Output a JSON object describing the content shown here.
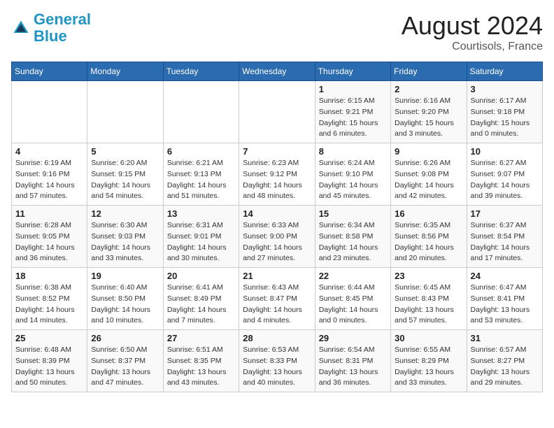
{
  "header": {
    "logo_line1": "General",
    "logo_line2": "Blue",
    "month": "August 2024",
    "location": "Courtisols, France"
  },
  "weekdays": [
    "Sunday",
    "Monday",
    "Tuesday",
    "Wednesday",
    "Thursday",
    "Friday",
    "Saturday"
  ],
  "weeks": [
    [
      {
        "day": "",
        "info": ""
      },
      {
        "day": "",
        "info": ""
      },
      {
        "day": "",
        "info": ""
      },
      {
        "day": "",
        "info": ""
      },
      {
        "day": "1",
        "info": "Sunrise: 6:15 AM\nSunset: 9:21 PM\nDaylight: 15 hours\nand 6 minutes."
      },
      {
        "day": "2",
        "info": "Sunrise: 6:16 AM\nSunset: 9:20 PM\nDaylight: 15 hours\nand 3 minutes."
      },
      {
        "day": "3",
        "info": "Sunrise: 6:17 AM\nSunset: 9:18 PM\nDaylight: 15 hours\nand 0 minutes."
      }
    ],
    [
      {
        "day": "4",
        "info": "Sunrise: 6:19 AM\nSunset: 9:16 PM\nDaylight: 14 hours\nand 57 minutes."
      },
      {
        "day": "5",
        "info": "Sunrise: 6:20 AM\nSunset: 9:15 PM\nDaylight: 14 hours\nand 54 minutes."
      },
      {
        "day": "6",
        "info": "Sunrise: 6:21 AM\nSunset: 9:13 PM\nDaylight: 14 hours\nand 51 minutes."
      },
      {
        "day": "7",
        "info": "Sunrise: 6:23 AM\nSunset: 9:12 PM\nDaylight: 14 hours\nand 48 minutes."
      },
      {
        "day": "8",
        "info": "Sunrise: 6:24 AM\nSunset: 9:10 PM\nDaylight: 14 hours\nand 45 minutes."
      },
      {
        "day": "9",
        "info": "Sunrise: 6:26 AM\nSunset: 9:08 PM\nDaylight: 14 hours\nand 42 minutes."
      },
      {
        "day": "10",
        "info": "Sunrise: 6:27 AM\nSunset: 9:07 PM\nDaylight: 14 hours\nand 39 minutes."
      }
    ],
    [
      {
        "day": "11",
        "info": "Sunrise: 6:28 AM\nSunset: 9:05 PM\nDaylight: 14 hours\nand 36 minutes."
      },
      {
        "day": "12",
        "info": "Sunrise: 6:30 AM\nSunset: 9:03 PM\nDaylight: 14 hours\nand 33 minutes."
      },
      {
        "day": "13",
        "info": "Sunrise: 6:31 AM\nSunset: 9:01 PM\nDaylight: 14 hours\nand 30 minutes."
      },
      {
        "day": "14",
        "info": "Sunrise: 6:33 AM\nSunset: 9:00 PM\nDaylight: 14 hours\nand 27 minutes."
      },
      {
        "day": "15",
        "info": "Sunrise: 6:34 AM\nSunset: 8:58 PM\nDaylight: 14 hours\nand 23 minutes."
      },
      {
        "day": "16",
        "info": "Sunrise: 6:35 AM\nSunset: 8:56 PM\nDaylight: 14 hours\nand 20 minutes."
      },
      {
        "day": "17",
        "info": "Sunrise: 6:37 AM\nSunset: 8:54 PM\nDaylight: 14 hours\nand 17 minutes."
      }
    ],
    [
      {
        "day": "18",
        "info": "Sunrise: 6:38 AM\nSunset: 8:52 PM\nDaylight: 14 hours\nand 14 minutes."
      },
      {
        "day": "19",
        "info": "Sunrise: 6:40 AM\nSunset: 8:50 PM\nDaylight: 14 hours\nand 10 minutes."
      },
      {
        "day": "20",
        "info": "Sunrise: 6:41 AM\nSunset: 8:49 PM\nDaylight: 14 hours\nand 7 minutes."
      },
      {
        "day": "21",
        "info": "Sunrise: 6:43 AM\nSunset: 8:47 PM\nDaylight: 14 hours\nand 4 minutes."
      },
      {
        "day": "22",
        "info": "Sunrise: 6:44 AM\nSunset: 8:45 PM\nDaylight: 14 hours\nand 0 minutes."
      },
      {
        "day": "23",
        "info": "Sunrise: 6:45 AM\nSunset: 8:43 PM\nDaylight: 13 hours\nand 57 minutes."
      },
      {
        "day": "24",
        "info": "Sunrise: 6:47 AM\nSunset: 8:41 PM\nDaylight: 13 hours\nand 53 minutes."
      }
    ],
    [
      {
        "day": "25",
        "info": "Sunrise: 6:48 AM\nSunset: 8:39 PM\nDaylight: 13 hours\nand 50 minutes."
      },
      {
        "day": "26",
        "info": "Sunrise: 6:50 AM\nSunset: 8:37 PM\nDaylight: 13 hours\nand 47 minutes."
      },
      {
        "day": "27",
        "info": "Sunrise: 6:51 AM\nSunset: 8:35 PM\nDaylight: 13 hours\nand 43 minutes."
      },
      {
        "day": "28",
        "info": "Sunrise: 6:53 AM\nSunset: 8:33 PM\nDaylight: 13 hours\nand 40 minutes."
      },
      {
        "day": "29",
        "info": "Sunrise: 6:54 AM\nSunset: 8:31 PM\nDaylight: 13 hours\nand 36 minutes."
      },
      {
        "day": "30",
        "info": "Sunrise: 6:55 AM\nSunset: 8:29 PM\nDaylight: 13 hours\nand 33 minutes."
      },
      {
        "day": "31",
        "info": "Sunrise: 6:57 AM\nSunset: 8:27 PM\nDaylight: 13 hours\nand 29 minutes."
      }
    ]
  ]
}
